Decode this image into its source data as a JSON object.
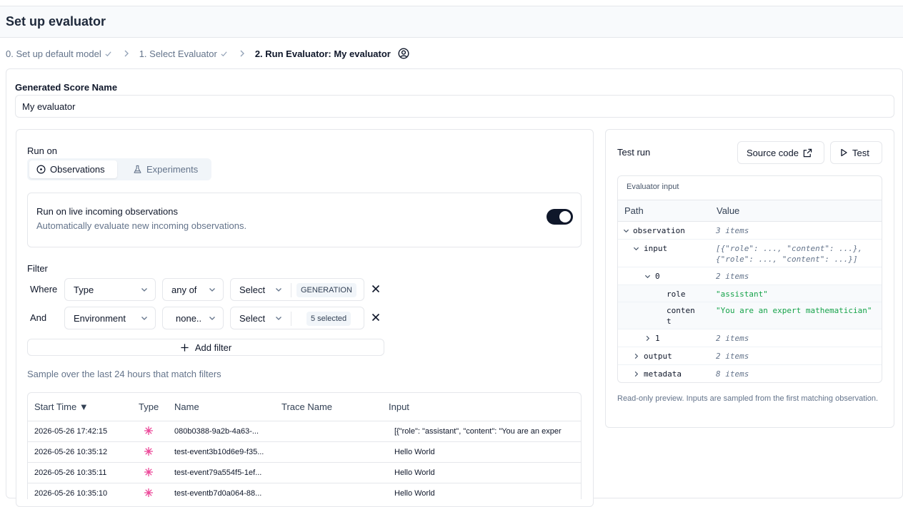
{
  "page": {
    "title": "Set up evaluator"
  },
  "breadcrumb": {
    "steps": [
      {
        "label": "0. Set up default model",
        "done": true
      },
      {
        "label": "1. Select Evaluator",
        "done": true
      },
      {
        "label": "2. Run Evaluator: My evaluator",
        "active": true
      }
    ]
  },
  "score": {
    "label": "Generated Score Name",
    "value": "My evaluator"
  },
  "run_on": {
    "label": "Run on",
    "tabs": [
      {
        "label": "Observations",
        "icon": "circle-dot-icon",
        "active": true
      },
      {
        "label": "Experiments",
        "icon": "flask-icon",
        "active": false
      }
    ],
    "live": {
      "title": "Run on live incoming observations",
      "description": "Automatically evaluate new incoming observations.",
      "enabled": true
    }
  },
  "filter": {
    "label": "Filter",
    "rows": [
      {
        "conjunction": "Where",
        "column": "Type",
        "operator": "any of",
        "value_select": "Select",
        "badge": "GENERATION"
      },
      {
        "conjunction": "And",
        "column": "Environment",
        "operator": "none..",
        "value_select": "Select",
        "badge": "5 selected"
      }
    ],
    "add_label": "Add filter"
  },
  "sample_text": "Sample over the last 24 hours that match filters",
  "table": {
    "columns": [
      "Start Time ▼",
      "Type",
      "Name",
      "Trace Name",
      "Input"
    ],
    "rows": [
      {
        "start_time": "2026-05-26 17:42:15",
        "type_icon": "generation-icon",
        "name": "080b0388-9a2b-4a63-...",
        "trace_name": "",
        "input": "[{\"role\": \"assistant\", \"content\": \"You are an exper"
      },
      {
        "start_time": "2026-05-26 10:35:12",
        "type_icon": "generation-icon",
        "name": "test-event3b10d6e9-f35...",
        "trace_name": "",
        "input": "Hello World"
      },
      {
        "start_time": "2026-05-26 10:35:11",
        "type_icon": "generation-icon",
        "name": "test-event79a554f5-1ef...",
        "trace_name": "",
        "input": "Hello World"
      },
      {
        "start_time": "2026-05-26 10:35:10",
        "type_icon": "generation-icon",
        "name": "test-eventb7d0a064-88...",
        "trace_name": "",
        "input": "Hello World"
      }
    ]
  },
  "test_run": {
    "title": "Test run",
    "source_code_label": "Source code",
    "test_label": "Test",
    "evaluator_input": {
      "title": "Evaluator input",
      "path_header": "Path",
      "value_header": "Value",
      "rows": [
        {
          "key": "observation",
          "value": "3 items",
          "kind": "meta"
        },
        {
          "key": "input",
          "value_line1": "[{\"role\": ..., \"content\": ...},",
          "value_line2": "{\"role\": ..., \"content\": ...}]",
          "kind": "meta"
        },
        {
          "key": "0",
          "value": "2 items",
          "kind": "meta"
        },
        {
          "key": "role",
          "value": "\"assistant\"",
          "kind": "str"
        },
        {
          "key_line1": "conten",
          "key_line2": "t",
          "value": "\"You are an expert mathematician\"",
          "kind": "str"
        },
        {
          "key": "1",
          "value": "2 items",
          "kind": "meta"
        },
        {
          "key": "output",
          "value": "2 items",
          "kind": "meta"
        },
        {
          "key": "metadata",
          "value": "8 items",
          "kind": "meta"
        }
      ]
    },
    "note": "Read-only preview. Inputs are sampled from the first matching observation."
  },
  "colors": {
    "accent": "#0f172a",
    "string_value": "#16a34a",
    "type_icon": "#ec4899",
    "border": "#e5e7eb"
  }
}
